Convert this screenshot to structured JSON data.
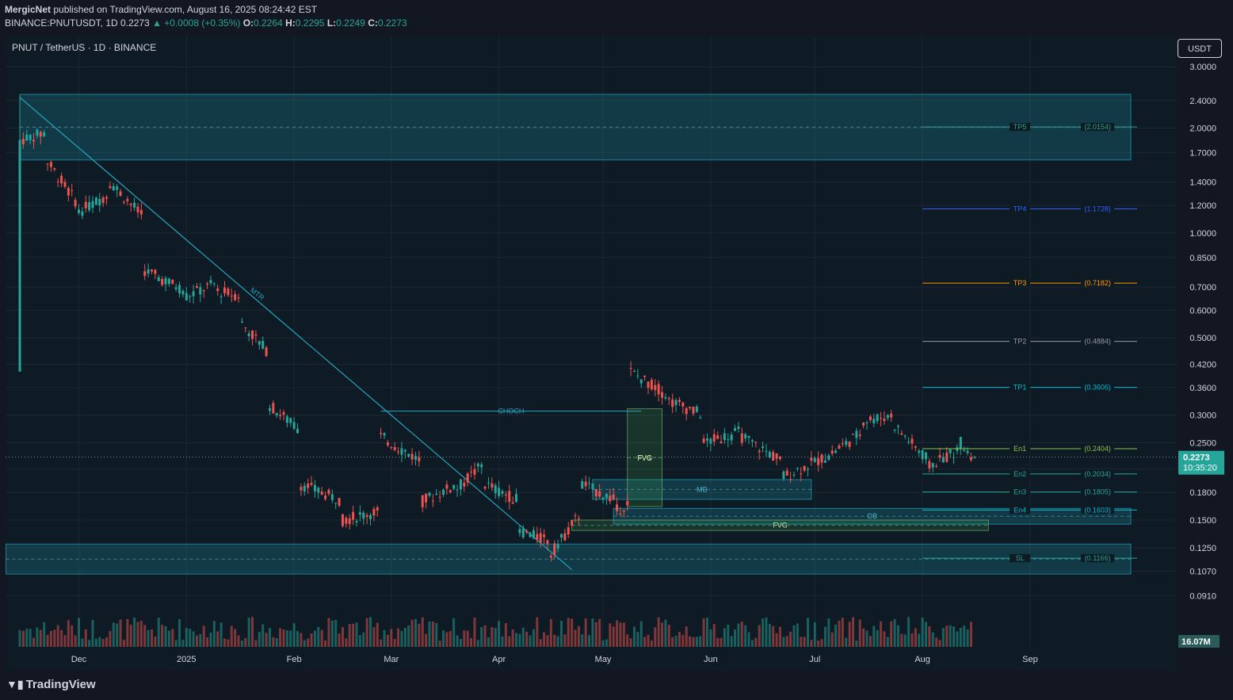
{
  "header": {
    "author": "MergicNet",
    "published": "published on TradingView.com, August 16, 2025 08:24:42 EST",
    "symbol_line": "BINANCE:PNUTUSDT, 1D",
    "last": "0.2273",
    "change": "▲ +0.0008 (+0.35%)",
    "o_label": "O:",
    "o": "0.2264",
    "h_label": "H:",
    "h": "0.2295",
    "l_label": "L:",
    "l": "0.2249",
    "c_label": "C:",
    "c": "0.2273"
  },
  "legend": "PNUT / TetherUS · 1D · BINANCE",
  "currency_button": "USDT",
  "brand": "TradingView",
  "colors": {
    "background": "#131722",
    "up": "#26a69a",
    "down": "#ef5350",
    "zone": "#22a7c0",
    "tp_green": "#2ca58d",
    "tp_blue": "#2962ff",
    "tp_orange": "#ff9800",
    "tp_gray": "#9598a1",
    "tp_cyan": "#00bcd4",
    "entry_green": "#8bc34a"
  },
  "chart_data": {
    "type": "candlestick",
    "symbol": "PNUTUSDT",
    "timeframe": "1D",
    "y_scale": "log",
    "ylim": [
      0.08,
      3.3
    ],
    "y_ticks": [
      "3.0000",
      "2.4000",
      "2.0000",
      "1.7000",
      "1.4000",
      "1.2000",
      "1.0000",
      "0.8500",
      "0.7000",
      "0.6000",
      "0.5000",
      "0.4200",
      "0.3600",
      "0.3000",
      "0.2500",
      "0.2100",
      "0.1800",
      "0.1500",
      "0.1250",
      "0.1070",
      "0.0910"
    ],
    "x_ticks": [
      "Dec",
      "2025",
      "Feb",
      "Mar",
      "Apr",
      "May",
      "Jun",
      "Jul",
      "Aug",
      "Sep"
    ],
    "x_range": [
      "2024-11-14",
      "2025-09-30"
    ],
    "ohlc": [
      {
        "date": "2024-11-14",
        "o": 0.4,
        "h": 2.49,
        "l": 0.4,
        "c": 1.85
      },
      {
        "date": "2024-11-22",
        "o": 1.95,
        "h": 2.3,
        "l": 1.55,
        "c": 1.6
      },
      {
        "date": "2024-12-01",
        "o": 1.2,
        "h": 1.4,
        "l": 1.05,
        "c": 1.15
      },
      {
        "date": "2024-12-10",
        "o": 1.3,
        "h": 1.55,
        "l": 1.15,
        "c": 1.4
      },
      {
        "date": "2024-12-20",
        "o": 1.1,
        "h": 1.2,
        "l": 0.72,
        "c": 0.78
      },
      {
        "date": "2025-01-01",
        "o": 0.68,
        "h": 0.76,
        "l": 0.6,
        "c": 0.66
      },
      {
        "date": "2025-01-10",
        "o": 0.72,
        "h": 0.8,
        "l": 0.62,
        "c": 0.68
      },
      {
        "date": "2025-01-17",
        "o": 0.66,
        "h": 0.7,
        "l": 0.52,
        "c": 0.55
      },
      {
        "date": "2025-01-25",
        "o": 0.45,
        "h": 0.5,
        "l": 0.3,
        "c": 0.32
      },
      {
        "date": "2025-02-03",
        "o": 0.27,
        "h": 0.29,
        "l": 0.16,
        "c": 0.19
      },
      {
        "date": "2025-02-15",
        "o": 0.17,
        "h": 0.19,
        "l": 0.14,
        "c": 0.15
      },
      {
        "date": "2025-02-26",
        "o": 0.16,
        "h": 0.31,
        "l": 0.15,
        "c": 0.26
      },
      {
        "date": "2025-03-10",
        "o": 0.22,
        "h": 0.24,
        "l": 0.16,
        "c": 0.17
      },
      {
        "date": "2025-03-20",
        "o": 0.19,
        "h": 0.2,
        "l": 0.165,
        "c": 0.185
      },
      {
        "date": "2025-03-28",
        "o": 0.22,
        "h": 0.23,
        "l": 0.18,
        "c": 0.19
      },
      {
        "date": "2025-04-07",
        "o": 0.17,
        "h": 0.175,
        "l": 0.135,
        "c": 0.14
      },
      {
        "date": "2025-04-16",
        "o": 0.13,
        "h": 0.15,
        "l": 0.115,
        "c": 0.12
      },
      {
        "date": "2025-04-25",
        "o": 0.16,
        "h": 0.2,
        "l": 0.15,
        "c": 0.19
      },
      {
        "date": "2025-05-05",
        "o": 0.17,
        "h": 0.18,
        "l": 0.145,
        "c": 0.16
      },
      {
        "date": "2025-05-09",
        "o": 0.17,
        "h": 0.48,
        "l": 0.16,
        "c": 0.4
      },
      {
        "date": "2025-05-20",
        "o": 0.34,
        "h": 0.41,
        "l": 0.3,
        "c": 0.33
      },
      {
        "date": "2025-05-30",
        "o": 0.3,
        "h": 0.32,
        "l": 0.24,
        "c": 0.25
      },
      {
        "date": "2025-06-10",
        "o": 0.27,
        "h": 0.31,
        "l": 0.24,
        "c": 0.26
      },
      {
        "date": "2025-06-22",
        "o": 0.22,
        "h": 0.23,
        "l": 0.18,
        "c": 0.2
      },
      {
        "date": "2025-07-05",
        "o": 0.23,
        "h": 0.25,
        "l": 0.21,
        "c": 0.23
      },
      {
        "date": "2025-07-15",
        "o": 0.27,
        "h": 0.3,
        "l": 0.24,
        "c": 0.29
      },
      {
        "date": "2025-07-24",
        "o": 0.3,
        "h": 0.34,
        "l": 0.27,
        "c": 0.28
      },
      {
        "date": "2025-08-03",
        "o": 0.22,
        "h": 0.235,
        "l": 0.205,
        "c": 0.215
      },
      {
        "date": "2025-08-12",
        "o": 0.24,
        "h": 0.265,
        "l": 0.22,
        "c": 0.25
      },
      {
        "date": "2025-08-16",
        "o": 0.2264,
        "h": 0.2295,
        "l": 0.2249,
        "c": 0.2273
      }
    ],
    "levels": [
      {
        "label": "TP5",
        "value": 2.0154,
        "text": "(2.0154)"
      },
      {
        "label": "TP4",
        "value": 1.1728,
        "text": "(1.1728)"
      },
      {
        "label": "TP3",
        "value": 0.7182,
        "text": "(0.7182)"
      },
      {
        "label": "TP2",
        "value": 0.4884,
        "text": "(0.4884)"
      },
      {
        "label": "TP1",
        "value": 0.3606,
        "text": "(0.3606)"
      },
      {
        "label": "En1",
        "value": 0.2404,
        "text": "(0.2404)"
      },
      {
        "label": "En2",
        "value": 0.2034,
        "text": "(0.2034)"
      },
      {
        "label": "En3",
        "value": 0.1805,
        "text": "(0.1805)"
      },
      {
        "label": "En4",
        "value": 0.1603,
        "text": "(0.1603)"
      },
      {
        "label": "SL",
        "value": 0.1166,
        "text": "(0.1166)"
      }
    ],
    "annotations": {
      "mtr": "MTR",
      "choch": "CHOCH",
      "fvg": "FVG",
      "mb": "MB",
      "ob": "OB"
    },
    "zones": [
      {
        "label": "",
        "from": "2024-11-14",
        "to": "2025-09-30",
        "low": 1.62,
        "high": 2.5
      },
      {
        "label": "",
        "from": "2024-11-10",
        "to": "2025-09-30",
        "low": 0.105,
        "high": 0.128
      },
      {
        "label": "MB",
        "from": "2025-04-28",
        "to": "2025-06-30",
        "low": 0.172,
        "high": 0.196
      },
      {
        "label": "OB",
        "from": "2025-05-04",
        "to": "2025-09-30",
        "low": 0.146,
        "high": 0.162
      },
      {
        "label": "FVG",
        "from": "2025-04-22",
        "to": "2025-08-20",
        "low": 0.14,
        "high": 0.15
      },
      {
        "label": "FVG",
        "from": "2025-05-08",
        "to": "2025-05-18",
        "low": 0.164,
        "high": 0.313
      }
    ],
    "last_price_label": "0.2273",
    "countdown": "10:35:20",
    "volume_label": "16.07M"
  }
}
